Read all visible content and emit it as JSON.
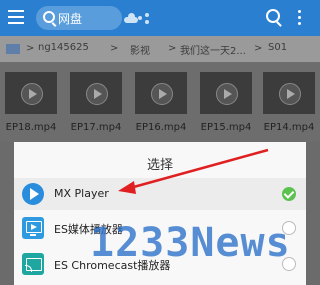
{
  "header": {
    "search_label": "网盘",
    "icons": [
      "menu-icon",
      "search-icon",
      "cloud-icon",
      "share-icon",
      "search-icon",
      "more-vert-icon"
    ]
  },
  "path": {
    "items": [
      "ng145625",
      "影视",
      "我们这一天2...",
      "S01"
    ]
  },
  "files": [
    {
      "name": "EP18.mp4"
    },
    {
      "name": "EP17.mp4"
    },
    {
      "name": "EP16.mp4"
    },
    {
      "name": "EP15.mp4"
    },
    {
      "name": "EP14.mp4"
    }
  ],
  "dialog": {
    "title": "选择",
    "options": [
      {
        "label": "MX Player",
        "icon": "mx-player-icon",
        "selected": true
      },
      {
        "label": "ES媒体播放器",
        "icon": "es-media-player-icon",
        "selected": false
      },
      {
        "label": "ES Chromecast播放器",
        "icon": "chromecast-icon",
        "selected": false
      }
    ]
  },
  "watermark": "1233News",
  "colors": {
    "topbar": "#2a7fd0",
    "arrow": "#e02020",
    "selected_check": "#5cc24f"
  }
}
